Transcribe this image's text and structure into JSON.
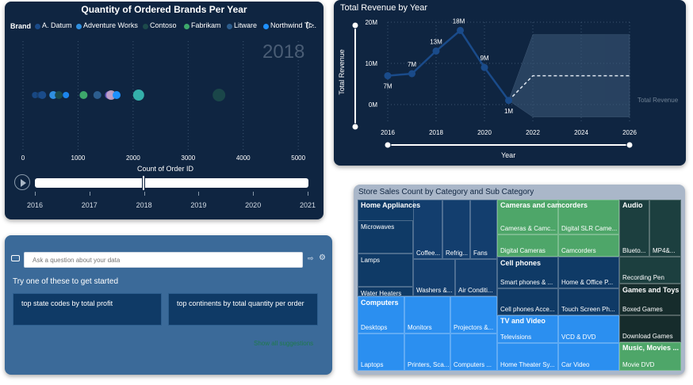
{
  "brands_chart": {
    "title": "Quantity of Ordered Brands Per Year",
    "legend_title": "Brand",
    "legend": [
      {
        "name": "A. Datum",
        "color": "#1a4b8a"
      },
      {
        "name": "Adventure Works",
        "color": "#2f8fe0"
      },
      {
        "name": "Contoso",
        "color": "#1c4a4a"
      },
      {
        "name": "Fabrikam",
        "color": "#3da86b"
      },
      {
        "name": "Litware",
        "color": "#2c5d8e"
      },
      {
        "name": "Northwind Tr...",
        "color": "#1e90ff"
      }
    ],
    "year_watermark": "2018",
    "xlabel": "Count of Order ID",
    "x_ticks": [
      "0",
      "1000",
      "2000",
      "3000",
      "4000",
      "5000"
    ],
    "play_years": [
      "2016",
      "2017",
      "2018",
      "2019",
      "2020",
      "2021"
    ],
    "legend_next_icon": "chevron-right-icon",
    "play_icon": "play-icon"
  },
  "revenue_chart": {
    "title": "Total Revenue by Year",
    "ylabel": "Total Revenue",
    "xlabel": "Year",
    "y_ticks": [
      "20M",
      "10M",
      "0M"
    ],
    "x_ticks": [
      "2016",
      "2018",
      "2020",
      "2022",
      "2024",
      "2026"
    ],
    "forecast_label": "Total Revenue",
    "data_labels": [
      "7M",
      "7M",
      "13M",
      "18M",
      "9M",
      "1M"
    ]
  },
  "qna": {
    "placeholder": "Ask a question about your data",
    "prompt": "Try one of these to get started",
    "suggestions": [
      "top state codes by total profit",
      "top continents by total quantity per order"
    ],
    "show_all": "Show all suggestions",
    "chat_icon": "chat-icon",
    "settings_icon": "gear-icon"
  },
  "treemap": {
    "title": "Store Sales Count by Category and Sub Category",
    "groups": {
      "home_appliances": "Home Appliances",
      "cameras": "Cameras and camcorders",
      "audio": "Audio",
      "cell_phones": "Cell phones",
      "games": "Games and Toys",
      "computers": "Computers",
      "tv": "TV and Video",
      "music": "Music, Movies ..."
    },
    "cells": {
      "microwaves": "Microwaves",
      "lamps": "Lamps",
      "water_heaters": "Water Heaters",
      "coffee": "Coffee...",
      "refrig": "Refrig...",
      "fans": "Fans",
      "washers": "Washers &...",
      "air_cond": "Air Conditi...",
      "cameras_camc": "Cameras & Camc...",
      "digital_slr": "Digital SLR Came...",
      "digital_cameras": "Digital Cameras",
      "camcorders": "Camcorders",
      "bluetooth": "Blueto...",
      "mp4": "MP4&...",
      "recording_pen": "Recording Pen",
      "smart_phones": "Smart phones & ...",
      "home_office": "Home & Office P...",
      "cell_acc": "Cell phones Acce...",
      "touch_screen": "Touch Screen Ph...",
      "boxed_games": "Boxed Games",
      "download_games": "Download Games",
      "desktops": "Desktops",
      "monitors": "Monitors",
      "projectors": "Projectors &...",
      "laptops": "Laptops",
      "printers": "Printers, Sca...",
      "computers_acc": "Computers ...",
      "televisions": "Televisions",
      "vcd": "VCD & DVD",
      "home_theater": "Home Theater Sy...",
      "car_video": "Car Video",
      "movie_dvd": "Movie DVD"
    }
  },
  "chart_data": [
    {
      "type": "scatter",
      "title": "Quantity of Ordered Brands Per Year",
      "xlabel": "Count of Order ID",
      "xlim": [
        0,
        5300
      ],
      "frame": "2018",
      "series": [
        {
          "name": "A. Datum",
          "x": 350
        },
        {
          "name": "Adventure Works",
          "x": 550
        },
        {
          "name": "Contoso",
          "x": 650
        },
        {
          "name": "Fabrikam",
          "x": 1100
        },
        {
          "name": "Litware",
          "x": 1350
        },
        {
          "name": "Northwind Tr...",
          "x": 1700
        }
      ]
    },
    {
      "type": "line",
      "title": "Total Revenue by Year",
      "xlabel": "Year",
      "ylabel": "Total Revenue",
      "x": [
        2016,
        2017,
        2018,
        2019,
        2020,
        2021
      ],
      "series": [
        {
          "name": "Total Revenue",
          "values": [
            7,
            7.5,
            13,
            18,
            9,
            1
          ]
        }
      ],
      "forecast": {
        "x": [
          2021,
          2022,
          2026
        ],
        "values": [
          1,
          7,
          7
        ],
        "upper": [
          1,
          17,
          17
        ],
        "lower": [
          1,
          -3,
          -3
        ]
      },
      "ylim": [
        0,
        20
      ],
      "xlim": [
        2016,
        2026
      ]
    }
  ]
}
